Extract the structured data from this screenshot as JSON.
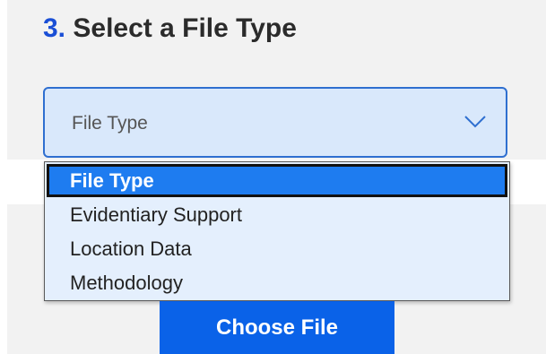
{
  "section": {
    "step_number": "3.",
    "title": "Select a File Type"
  },
  "file_type_select": {
    "selected_value": "File Type",
    "icon": "chevron-down-icon",
    "options": [
      {
        "label": "File Type",
        "selected": true
      },
      {
        "label": "Evidentiary Support",
        "selected": false
      },
      {
        "label": "Location Data",
        "selected": false
      },
      {
        "label": "Methodology",
        "selected": false
      }
    ]
  },
  "upload": {
    "choose_file_label": "Choose File"
  },
  "colors": {
    "accent": "#1a4fd6",
    "button": "#0a62e8",
    "select_bg": "#d9e8fb",
    "option_highlight": "#1e7cf0"
  }
}
